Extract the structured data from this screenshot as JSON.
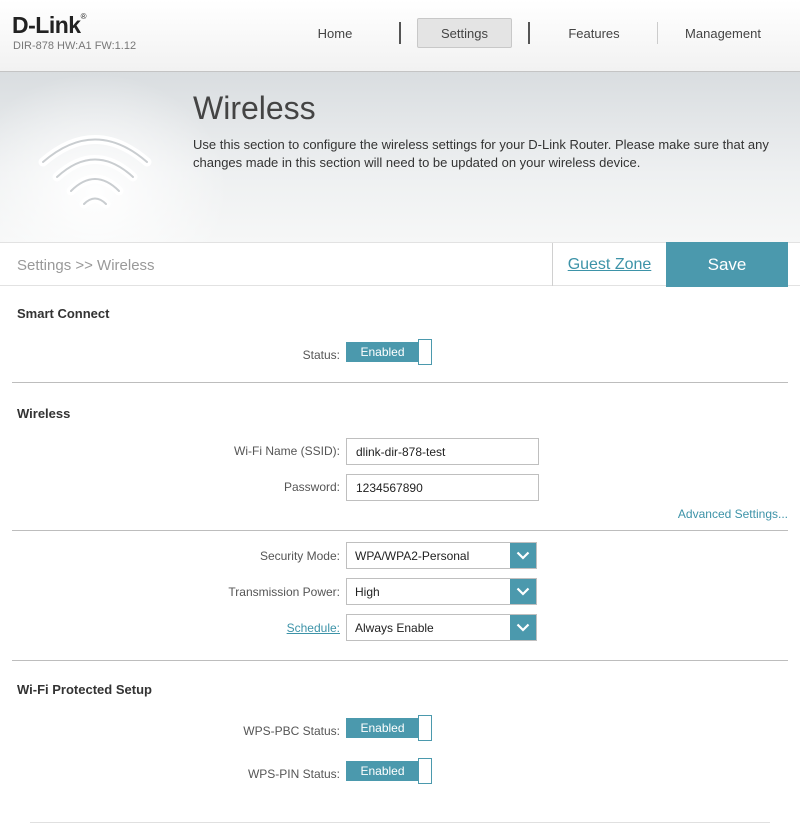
{
  "header": {
    "logo": "D-Link",
    "logo_mark": "®",
    "model": "DIR-878 HW:A1 FW:1.12",
    "nav": {
      "home": "Home",
      "settings": "Settings",
      "features": "Features",
      "management": "Management"
    }
  },
  "banner": {
    "title": "Wireless",
    "description": "Use this section to configure the wireless settings for your D-Link Router. Please make sure that any changes made in this section will need to be updated on your wireless device."
  },
  "toolbar": {
    "breadcrumb": "Settings >> Wireless",
    "guest_zone": "Guest Zone",
    "save": "Save"
  },
  "smart_connect": {
    "title": "Smart Connect",
    "status_label": "Status:",
    "status_value": "Enabled"
  },
  "wireless": {
    "title": "Wireless",
    "ssid_label": "Wi-Fi Name (SSID):",
    "ssid_value": "dlink-dir-878-test",
    "password_label": "Password:",
    "password_value": "1234567890",
    "advanced_link": "Advanced Settings..."
  },
  "security": {
    "mode_label": "Security Mode:",
    "mode_value": "WPA/WPA2-Personal",
    "power_label": "Transmission Power:",
    "power_value": "High",
    "schedule_label": "Schedule:",
    "schedule_value": "Always Enable"
  },
  "wps": {
    "title": "Wi-Fi Protected Setup",
    "pbc_label": "WPS-PBC Status:",
    "pbc_value": "Enabled",
    "pin_label": "WPS-PIN Status:",
    "pin_value": "Enabled"
  },
  "colors": {
    "accent": "#4b99ad",
    "link": "#3d93a8"
  },
  "icons": {
    "banner": "wifi-icon",
    "select_arrow": "chevron-down-icon"
  }
}
